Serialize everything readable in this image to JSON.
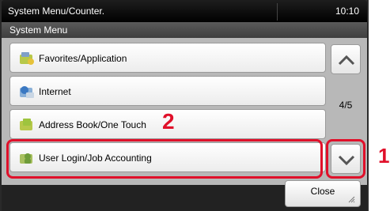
{
  "header": {
    "title": "System Menu/Counter.",
    "time": "10:10"
  },
  "subheader": {
    "title": "System Menu"
  },
  "list": {
    "items": [
      {
        "label": "Favorites/Application",
        "icon": "favorites-icon"
      },
      {
        "label": "Internet",
        "icon": "internet-icon"
      },
      {
        "label": "Address Book/One Touch",
        "icon": "address-book-icon"
      },
      {
        "label": "User Login/Job Accounting",
        "icon": "user-login-icon"
      }
    ]
  },
  "scroll": {
    "page_indicator": "4/5",
    "up_icon": "chevron-up-icon",
    "down_icon": "chevron-down-icon"
  },
  "footer": {
    "close_label": "Close"
  },
  "callouts": {
    "first": "1",
    "second": "2"
  },
  "colors": {
    "callout": "#e0102a",
    "titlebar": "#000000",
    "list_bg": "#b8b8b8"
  }
}
